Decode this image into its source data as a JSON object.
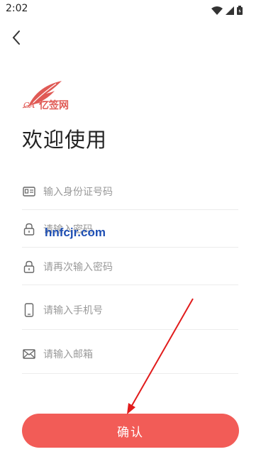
{
  "status_bar": {
    "time": "2:02"
  },
  "logo": {
    "ca_text": "CA",
    "brand_text": "亿签网"
  },
  "welcome_title": "欢迎使用",
  "fields": [
    {
      "placeholder": "输入身份证号码",
      "icon": "id-card-icon"
    },
    {
      "placeholder": "请输入密码",
      "icon": "lock-icon"
    },
    {
      "placeholder": "请再次输入密码",
      "icon": "lock-icon"
    },
    {
      "placeholder": "请输入手机号",
      "icon": "phone-icon"
    },
    {
      "placeholder": "请输入邮箱",
      "icon": "mail-icon"
    }
  ],
  "watermark": "hnfcjr.com",
  "confirm_button": "确认",
  "colors": {
    "accent": "#f25c57",
    "watermark": "#1e4fb4",
    "annotation_arrow": "#e11b1b"
  }
}
